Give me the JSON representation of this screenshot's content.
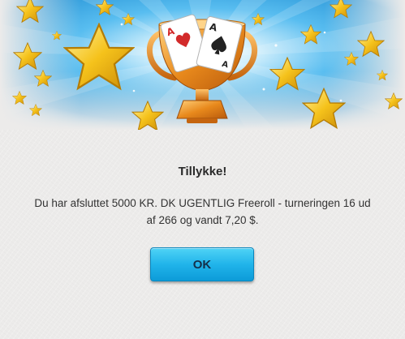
{
  "dialog": {
    "illustration": "trophy-with-cards-icon",
    "title": "Tillykke!",
    "message": "Du har afsluttet 5000 KR. DK UGENTLIG Freeroll - turneringen 16 ud af 266 og vandt 7,20 $.",
    "ok_label": "OK"
  },
  "colors": {
    "banner_sky": "#2fa3e0",
    "trophy_gold": "#e8891c",
    "button_blue": "#21b4ea",
    "star_gold": "#f5c21b"
  }
}
